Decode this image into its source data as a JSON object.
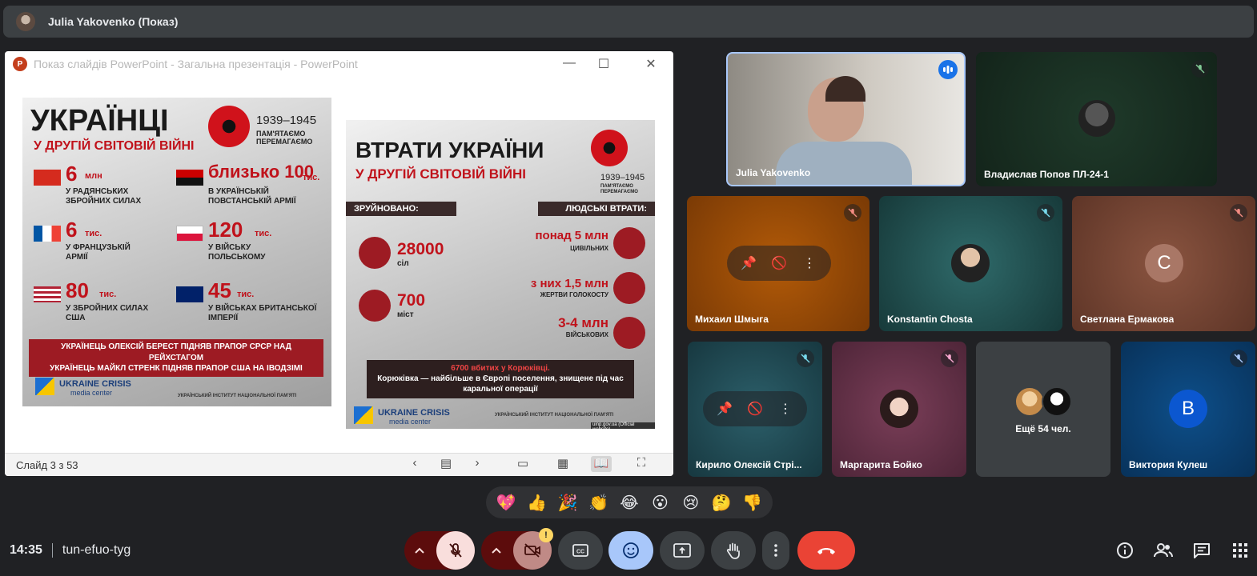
{
  "topbar": {
    "title": "Julia Yakovenko (Показ)"
  },
  "share": {
    "window_title": "Показ слайдів PowerPoint  -  Загальна презентація - PowerPoint",
    "logo_letter": "P",
    "minimize": "—",
    "maximize": "☐",
    "close": "✕",
    "status_text": "Слайд 3 з 53",
    "icons": {
      "prev": "‹",
      "all_slides": "▤",
      "next": "›",
      "normal": "▭",
      "sorter": "▦",
      "reading": "📖",
      "slideshow": "⛶"
    }
  },
  "slide": {
    "left": {
      "title": "УКРАЇНЦІ",
      "subtitle": "У ДРУГІЙ СВІТОВІЙ ВІЙНІ",
      "years": "1939–1945",
      "motto": "ПАМ'ЯТАЄМО ПЕРЕМАГАЄМО",
      "stats": [
        {
          "num": "6",
          "unit": "млн",
          "text": "У РАДЯНСЬКИХ ЗБРОЙНИХ СИЛАХ"
        },
        {
          "num": "близько 100",
          "unit": "тис.",
          "text": "В УКРАЇНСЬКІЙ ПОВСТАНСЬКІЙ АРМІЇ"
        },
        {
          "num": "6",
          "unit": "тис.",
          "text": "У ФРАНЦУЗЬКІЙ АРМІЇ"
        },
        {
          "num": "120",
          "unit": "тис.",
          "text": "У ВІЙСЬКУ ПОЛЬСЬКОМУ"
        },
        {
          "num": "80",
          "unit": "тис.",
          "text": "У ЗБРОЙНИХ СИЛАХ США"
        },
        {
          "num": "45",
          "unit": "тис.",
          "text": "У ВІЙСЬКАХ БРИТАНСЬКОЇ ІМПЕРІЇ"
        }
      ],
      "banner": "УКРАЇНЕЦЬ ОЛЕКСІЙ БЕРЕСТ ПІДНЯВ ПРАПОР СРСР НАД РЕЙХСТАГОМ\nУКРАЇНЕЦЬ МАЙКЛ СТРЕНК ПІДНЯВ ПРАПОР США НА ІВОДЗІМІ",
      "brand": "UKRAINE CRISIS",
      "brand_sub": "media center",
      "footer": "УКРАЇНСЬКИЙ ІНСТИТУТ НАЦІОНАЛЬНОЇ ПАМ'ЯТІ"
    },
    "right": {
      "title": "ВТРАТИ УКРАЇНИ",
      "subtitle": "У ДРУГІЙ СВІТОВІЙ ВІЙНІ",
      "years": "1939–1945",
      "motto": "ПАМ'ЯТАЄМО ПЕРЕМАГАЄМО",
      "destroyed_label": "ЗРУЙНОВАНО:",
      "losses_label": "ЛЮДСЬКІ ВТРАТИ:",
      "destroyed": [
        {
          "num": "28000",
          "text": "сіл"
        },
        {
          "num": "700",
          "text": "міст"
        }
      ],
      "losses": [
        {
          "num": "понад 5 млн",
          "text": "ЦИВІЛЬНИХ"
        },
        {
          "num": "з них 1,5 млн",
          "text": "ЖЕРТВИ ГОЛОКОСТУ"
        },
        {
          "num": "3-4 млн",
          "text": "ВІЙСЬКОВИХ"
        }
      ],
      "bottom_line1": "6700 вбитих у Корюківці.",
      "bottom_line2": "Корюківка — найбільше в Європі поселення, знищене під час каральної операції",
      "brand": "UKRAINE CRISIS",
      "brand_sub": "media center",
      "footer": "УКРАЇНСЬКИЙ ІНСТИТУТ НАЦІОНАЛЬНОЇ ПАМ'ЯТІ",
      "site": "uinp.gov.ua (Official website)"
    }
  },
  "participants": [
    {
      "name": "Julia Yakovenko"
    },
    {
      "name": "Владислав Попов ПЛ-24-1"
    },
    {
      "name": "Михаил Шмыга"
    },
    {
      "name": "Konstantin Chosta"
    },
    {
      "name": "Светлана Ермакова",
      "initial": "С"
    },
    {
      "name": "Кирило Олексій Стрі..."
    },
    {
      "name": "Маргарита Бойко"
    },
    {
      "name": "Ещё 54 чел."
    },
    {
      "name": "Виктория Кулеш",
      "initial": "В"
    }
  ],
  "hover_icons": {
    "pin": "📌",
    "mute": "🚫",
    "more": "⋮"
  },
  "reactions": [
    "💖",
    "👍",
    "🎉",
    "👏",
    "😂",
    "😮",
    "😢",
    "🤔",
    "👎"
  ],
  "meeting": {
    "time": "14:35",
    "code": "tun-efuo-tyg"
  },
  "colors": {
    "end_call": "#ea4335",
    "accent_blue": "#1a73e8",
    "mic_off_bg": "#f9dedc",
    "dark_red": "#5c0c0c"
  },
  "toolbar": {
    "cam_warning": "!"
  }
}
